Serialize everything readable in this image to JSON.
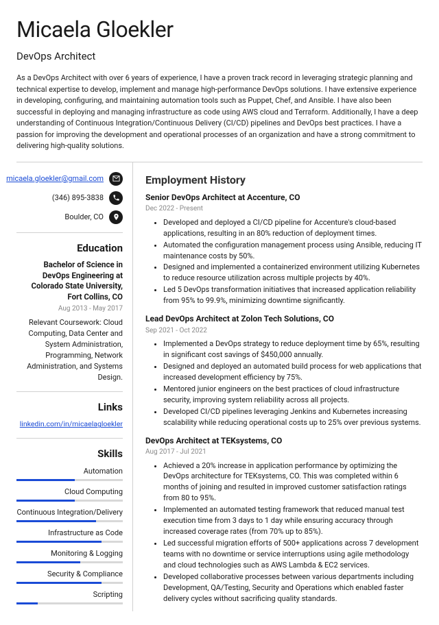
{
  "name": "Micaela Gloekler",
  "title": "DevOps Architect",
  "summary": "As a DevOps Architect with over 6 years of experience, I have a proven track record in leveraging strategic planning and technical expertise to develop, implement and manage high-performance DevOps solutions. I have extensive experience in developing, configuring, and maintaining automation tools such as Puppet, Chef, and Ansible. I have also been successful in deploying and managing infrastructure as code using AWS cloud and Terraform. Additionally, I have a deep understanding of Continuous Integration/Continuous Delivery (CI/CD) pipelines and DevOps best practices. I have a passion for improving the development and operational processes of an organization and have a strong commitment to delivering high-quality solutions.",
  "contact": {
    "email": "micaela.gloekler@gmail.com",
    "phone": "(346) 895-3838",
    "location": "Boulder, CO"
  },
  "headings": {
    "education": "Education",
    "links": "Links",
    "skills": "Skills",
    "employment": "Employment History"
  },
  "education": {
    "degree": "Bachelor of Science in DevOps Engineering at Colorado State University, Fort Collins, CO",
    "dates": "Aug 2013 - May 2017",
    "desc": "Relevant Coursework: Cloud Computing, Data Center and System Administration, Programming, Network Administration, and Systems Design."
  },
  "links": [
    "linkedin.com/in/micaelagloekler"
  ],
  "skills": [
    {
      "name": "Automation",
      "level": 55
    },
    {
      "name": "Cloud Computing",
      "level": 55
    },
    {
      "name": "Continuous Integration/Delivery",
      "level": 75
    },
    {
      "name": "Infrastructure as Code",
      "level": 80
    },
    {
      "name": "Monitoring & Logging",
      "level": 60
    },
    {
      "name": "Security & Compliance",
      "level": 80
    },
    {
      "name": "Scripting",
      "level": 20
    }
  ],
  "jobs": [
    {
      "title": "Senior DevOps Architect at Accenture, CO",
      "dates": "Dec 2022 - Present",
      "bullets": [
        "Developed and deployed a CI/CD pipeline for Accenture's cloud-based applications, resulting in an 80% reduction of deployment times.",
        "Automated the configuration management process using Ansible, reducing IT maintenance costs by 50%.",
        "Designed and implemented a containerized environment utilizing Kubernetes to reduce resource utilization across multiple projects by 40%.",
        "Led 5 DevOps transformation initiatives that increased application reliability from 95% to 99.9%, minimizing downtime significantly."
      ]
    },
    {
      "title": "Lead DevOps Architect at Zolon Tech Solutions, CO",
      "dates": "Sep 2021 - Oct 2022",
      "bullets": [
        "Implemented a DevOps strategy to reduce deployment time by 65%, resulting in significant cost savings of $450,000 annually.",
        "Designed and deployed an automated build process for web applications that increased development efficiency by 75%.",
        "Mentored junior engineers on the best practices of cloud infrastructure security, improving system reliability across all projects.",
        "Developed CI/CD pipelines leveraging Jenkins and Kubernetes increasing scalability while reducing operational costs up to 25% over previous systems."
      ]
    },
    {
      "title": "DevOps Architect at TEKsystems, CO",
      "dates": "Aug 2017 - Jul 2021",
      "bullets": [
        "Achieved a 20% increase in application performance by optimizing the DevOps architecture for TEKsystems, CO. This was completed within 6 months of joining and resulted in improved customer satisfaction ratings from 80 to 95%.",
        "Implemented an automated testing framework that reduced manual test execution time from 3 days to 1 day while ensuring accuracy through increased coverage rates (from 70% up to 85%).",
        "Led successful migration efforts of 500+ applications across 7 development teams with no downtime or service interruptions using agile methodology and cloud technologies such as AWS Lambda & EC2 services.",
        "Developed collaborative processes between various departments including Development, QA/Testing, Security and Operations which enabled faster delivery cycles without sacrificing quality standards."
      ]
    }
  ]
}
